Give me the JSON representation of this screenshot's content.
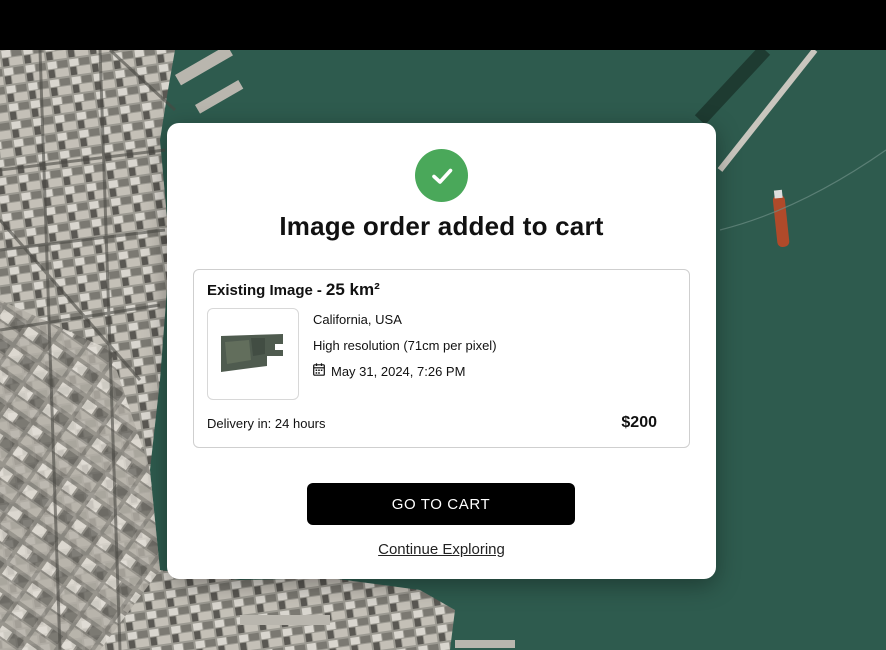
{
  "modal": {
    "title": "Image order added to cart",
    "status_icon": "check-circle-icon",
    "accent_color": "#4aa85a"
  },
  "order": {
    "label": "Existing Image",
    "separator": "-",
    "area": "25 km²",
    "location": "California, USA",
    "resolution": "High resolution (71cm per pixel)",
    "date_icon": "calendar-icon",
    "date": "May 31, 2024, 7:26 PM",
    "delivery": "Delivery in: 24 hours",
    "price": "$200"
  },
  "actions": {
    "primary_label": "GO TO CART",
    "secondary_label": "Continue Exploring"
  }
}
